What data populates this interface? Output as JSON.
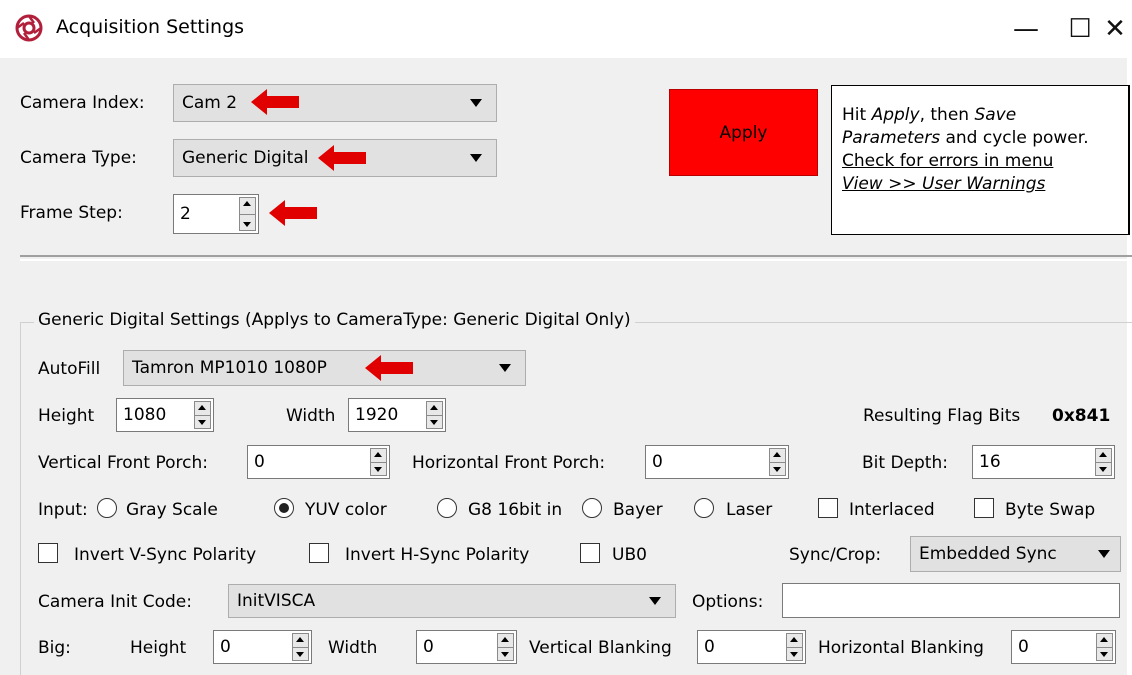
{
  "window": {
    "title": "Acquisition Settings",
    "icon": "app-logo-icon",
    "controls": {
      "minimize": "—",
      "maximize": "☐",
      "close": "✕"
    }
  },
  "camera_index": {
    "label": "Camera Index:",
    "value": "Cam 2"
  },
  "camera_type": {
    "label": "Camera Type:",
    "value": "Generic Digital"
  },
  "frame_step": {
    "label": "Frame Step:",
    "value": "2"
  },
  "apply_label": "Apply",
  "note": {
    "part1": "Hit ",
    "apply_word": "Apply",
    "part2": ", then ",
    "save_word": "Save",
    "parameters_word": "Parameters",
    "part3": " and cycle power.",
    "link1": "Check for errors in menu",
    "link2": "View >> User Warnings"
  },
  "generic": {
    "group_title": "Generic Digital Settings (Applys to CameraType: Generic Digital Only)",
    "autofill_label": "AutoFill",
    "autofill_value": "Tamron MP1010 1080P",
    "height_label": "Height",
    "height_value": "1080",
    "width_label": "Width",
    "width_value": "1920",
    "flag_label": "Resulting Flag Bits",
    "flag_value": "0x841",
    "vfp_label": "Vertical Front Porch:",
    "vfp_value": "0",
    "hfp_label": "Horizontal Front Porch:",
    "hfp_value": "0",
    "bitdepth_label": "Bit Depth:",
    "bitdepth_value": "16",
    "input_label": "Input:",
    "inputs": [
      "Gray Scale",
      "YUV color",
      "G8 16bit in",
      "Bayer",
      "Laser"
    ],
    "selected_input": "YUV color",
    "interlaced_label": "Interlaced",
    "byteswap_label": "Byte Swap",
    "invert_v_label": "Invert V-Sync Polarity",
    "invert_h_label": "Invert H-Sync Polarity",
    "ub0_label": "UB0",
    "sync_label": "Sync/Crop:",
    "sync_value": "Embedded Sync",
    "init_label": "Camera Init Code:",
    "init_value": "InitVISCA",
    "options_label": "Options:",
    "options_value": "",
    "big_label": "Big:",
    "big_height_label": "Height",
    "big_height_value": "0",
    "big_width_label": "Width",
    "big_width_value": "0",
    "vblank_label": "Vertical Blanking",
    "vblank_value": "0",
    "hblank_label": "Horizontal Blanking",
    "hblank_value": "0"
  },
  "colors": {
    "apply_bg": "#ff0000",
    "annotation_arrow": "#e00000",
    "window_bg": "#f0f0f0"
  }
}
